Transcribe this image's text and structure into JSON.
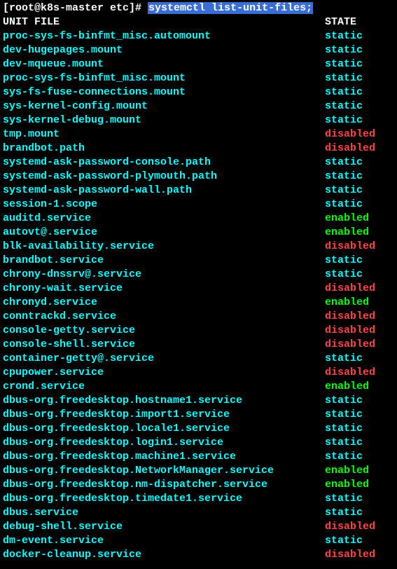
{
  "prompt": {
    "left": "[root@k8s-master etc]# ",
    "cmd": "systemctl list-unit-files;"
  },
  "header": {
    "unit": "UNIT FILE",
    "state": "STATE"
  },
  "rows": [
    {
      "unit": "proc-sys-fs-binfmt_misc.automount",
      "state": "static"
    },
    {
      "unit": "dev-hugepages.mount",
      "state": "static"
    },
    {
      "unit": "dev-mqueue.mount",
      "state": "static"
    },
    {
      "unit": "proc-sys-fs-binfmt_misc.mount",
      "state": "static"
    },
    {
      "unit": "sys-fs-fuse-connections.mount",
      "state": "static"
    },
    {
      "unit": "sys-kernel-config.mount",
      "state": "static"
    },
    {
      "unit": "sys-kernel-debug.mount",
      "state": "static"
    },
    {
      "unit": "tmp.mount",
      "state": "disabled"
    },
    {
      "unit": "brandbot.path",
      "state": "disabled"
    },
    {
      "unit": "systemd-ask-password-console.path",
      "state": "static"
    },
    {
      "unit": "systemd-ask-password-plymouth.path",
      "state": "static"
    },
    {
      "unit": "systemd-ask-password-wall.path",
      "state": "static"
    },
    {
      "unit": "session-1.scope",
      "state": "static"
    },
    {
      "unit": "auditd.service",
      "state": "enabled"
    },
    {
      "unit": "autovt@.service",
      "state": "enabled"
    },
    {
      "unit": "blk-availability.service",
      "state": "disabled"
    },
    {
      "unit": "brandbot.service",
      "state": "static"
    },
    {
      "unit": "chrony-dnssrv@.service",
      "state": "static"
    },
    {
      "unit": "chrony-wait.service",
      "state": "disabled"
    },
    {
      "unit": "chronyd.service",
      "state": "enabled"
    },
    {
      "unit": "conntrackd.service",
      "state": "disabled"
    },
    {
      "unit": "console-getty.service",
      "state": "disabled"
    },
    {
      "unit": "console-shell.service",
      "state": "disabled"
    },
    {
      "unit": "container-getty@.service",
      "state": "static"
    },
    {
      "unit": "cpupower.service",
      "state": "disabled"
    },
    {
      "unit": "crond.service",
      "state": "enabled"
    },
    {
      "unit": "dbus-org.freedesktop.hostname1.service",
      "state": "static"
    },
    {
      "unit": "dbus-org.freedesktop.import1.service",
      "state": "static"
    },
    {
      "unit": "dbus-org.freedesktop.locale1.service",
      "state": "static"
    },
    {
      "unit": "dbus-org.freedesktop.login1.service",
      "state": "static"
    },
    {
      "unit": "dbus-org.freedesktop.machine1.service",
      "state": "static"
    },
    {
      "unit": "dbus-org.freedesktop.NetworkManager.service",
      "state": "enabled"
    },
    {
      "unit": "dbus-org.freedesktop.nm-dispatcher.service",
      "state": "enabled"
    },
    {
      "unit": "dbus-org.freedesktop.timedate1.service",
      "state": "static"
    },
    {
      "unit": "dbus.service",
      "state": "static"
    },
    {
      "unit": "debug-shell.service",
      "state": "disabled"
    },
    {
      "unit": "dm-event.service",
      "state": "static"
    },
    {
      "unit": "docker-cleanup.service",
      "state": "disabled"
    }
  ]
}
